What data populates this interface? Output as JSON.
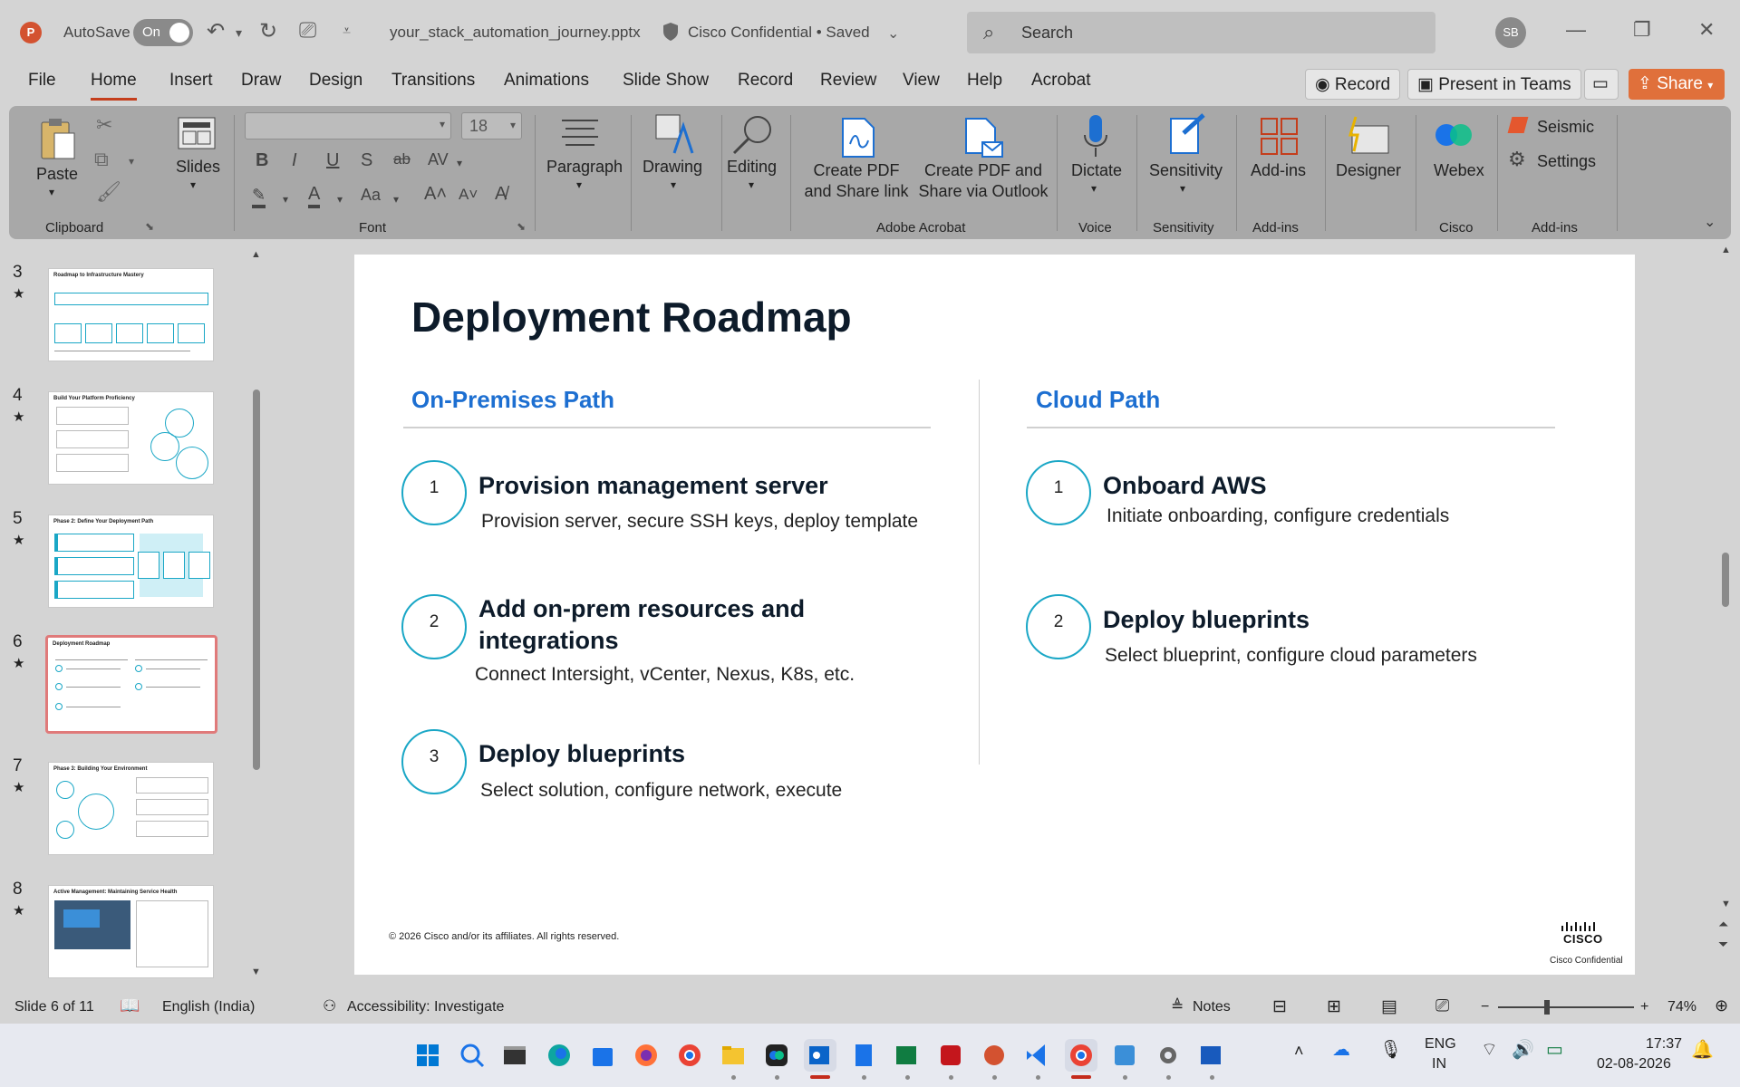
{
  "titlebar": {
    "autosave_label": "AutoSave",
    "autosave_state": "On",
    "filename": "your_stack_automation_journey.pptx",
    "classification": "Cisco Confidential • Saved",
    "search_placeholder": "Search",
    "avatar_initials": "SB",
    "app_logo": "P"
  },
  "menu": {
    "tabs": [
      "File",
      "Home",
      "Insert",
      "Draw",
      "Design",
      "Transitions",
      "Animations",
      "Slide Show",
      "Record",
      "Review",
      "View",
      "Help",
      "Acrobat"
    ],
    "active_tab": "Home",
    "record_label": "Record",
    "present_teams_label": "Present in Teams",
    "share_label": "Share"
  },
  "ribbon": {
    "paste_label": "Paste",
    "clipboard_label": "Clipboard",
    "slides_label": "Slides",
    "font_label": "Font",
    "font_size": "18",
    "paragraph_label": "Paragraph",
    "drawing_label": "Drawing",
    "editing_label": "Editing",
    "create_pdf_share_link": "Create PDF and Share link",
    "create_pdf_outlook": "Create PDF and Share via Outlook",
    "adobe_acrobat_label": "Adobe Acrobat",
    "dictate_label": "Dictate",
    "voice_label": "Voice",
    "sensitivity_label": "Sensitivity",
    "sensitivity_group": "Sensitivity",
    "addins_label": "Add-ins",
    "addins_group": "Add-ins",
    "designer_label": "Designer",
    "webex_label": "Webex",
    "cisco_group": "Cisco",
    "seismic_label": "Seismic",
    "settings_label": "Settings",
    "addins_group2": "Add-ins"
  },
  "thumbnails": [
    {
      "number": "3",
      "title": "Roadmap to Infrastructure Mastery"
    },
    {
      "number": "4",
      "title": "Build Your Platform Proficiency"
    },
    {
      "number": "5",
      "title": "Phase 2: Define Your Deployment Path"
    },
    {
      "number": "6",
      "title": "Deployment Roadmap"
    },
    {
      "number": "7",
      "title": "Phase 3: Building Your Environment"
    },
    {
      "number": "8",
      "title": "Active Management: Maintaining Service Health"
    }
  ],
  "slide": {
    "title": "Deployment Roadmap",
    "left_heading": "On-Premises Path",
    "right_heading": "Cloud Path",
    "left_steps": [
      {
        "num": "1",
        "title": "Provision management server",
        "desc": "Provision server, secure SSH keys, deploy template"
      },
      {
        "num": "2",
        "title": "Add on-prem resources and integrations",
        "desc": "Connect Intersight, vCenter, Nexus, K8s, etc."
      },
      {
        "num": "3",
        "title": "Deploy blueprints",
        "desc": "Select solution, configure network, execute"
      }
    ],
    "right_steps": [
      {
        "num": "1",
        "title": "Onboard AWS",
        "desc": "Initiate onboarding, configure credentials"
      },
      {
        "num": "2",
        "title": "Deploy blueprints",
        "desc": "Select blueprint, configure cloud parameters"
      }
    ],
    "copyright": "© 2026 Cisco and/or its affiliates. All rights reserved.",
    "cisco_wordmark": "CISCO",
    "confidential": "Cisco Confidential"
  },
  "status": {
    "slide_count": "Slide 6 of 11",
    "language": "English (India)",
    "accessibility": "Accessibility: Investigate",
    "notes": "Notes",
    "zoom": "74%"
  },
  "taskbar": {
    "lang_top": "ENG",
    "lang_bottom": "IN",
    "time": "17:37",
    "date": "02-08-2026"
  },
  "colors": {
    "accent_blue": "#1d6fd1",
    "step_circle": "#1aa7c6",
    "share": "#e0703b",
    "ppt_brand": "#d35230"
  }
}
